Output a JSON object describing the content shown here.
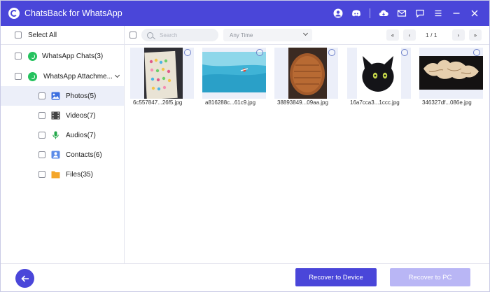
{
  "app": {
    "title": "ChatsBack for WhatsApp",
    "accent": "#4a46d9",
    "titlebar_icons": [
      "account-icon",
      "discord-icon",
      "cloud-icon",
      "mail-icon",
      "feedback-icon",
      "menu-icon",
      "minimize-icon",
      "close-icon"
    ]
  },
  "sidebar": {
    "select_all": "Select All",
    "chats": "WhatsApp Chats(3)",
    "attachments": "WhatsApp Attachme...",
    "categories": [
      {
        "label": "Photos(5)",
        "icon": "photos-icon",
        "selected": true
      },
      {
        "label": "Videos(7)",
        "icon": "videos-icon",
        "selected": false
      },
      {
        "label": "Audios(7)",
        "icon": "audios-icon",
        "selected": false
      },
      {
        "label": "Contacts(6)",
        "icon": "contacts-icon",
        "selected": false
      },
      {
        "label": "Files(35)",
        "icon": "files-icon",
        "selected": false
      }
    ]
  },
  "toolbar": {
    "search_placeholder": "Search",
    "time_filter": "Any Time",
    "page_indicator": "1 / 1",
    "first_label": "«",
    "prev_label": "‹",
    "next_label": "›",
    "last_label": "»"
  },
  "photos": [
    {
      "filename": "6c557847...26f5.jpg",
      "subject": "colored dots paper"
    },
    {
      "filename": "a816288c...61c9.jpg",
      "subject": "ocean swimmer"
    },
    {
      "filename": "38893849...09aa.jpg",
      "subject": "wooden cutting board"
    },
    {
      "filename": "16a7cca3...1ccc.jpg",
      "subject": "black cartoon creature"
    },
    {
      "filename": "346327df...086e.jpg",
      "subject": "ornamental banner"
    }
  ],
  "footer": {
    "recover_device": "Recover to Device",
    "recover_pc": "Recover to PC"
  }
}
